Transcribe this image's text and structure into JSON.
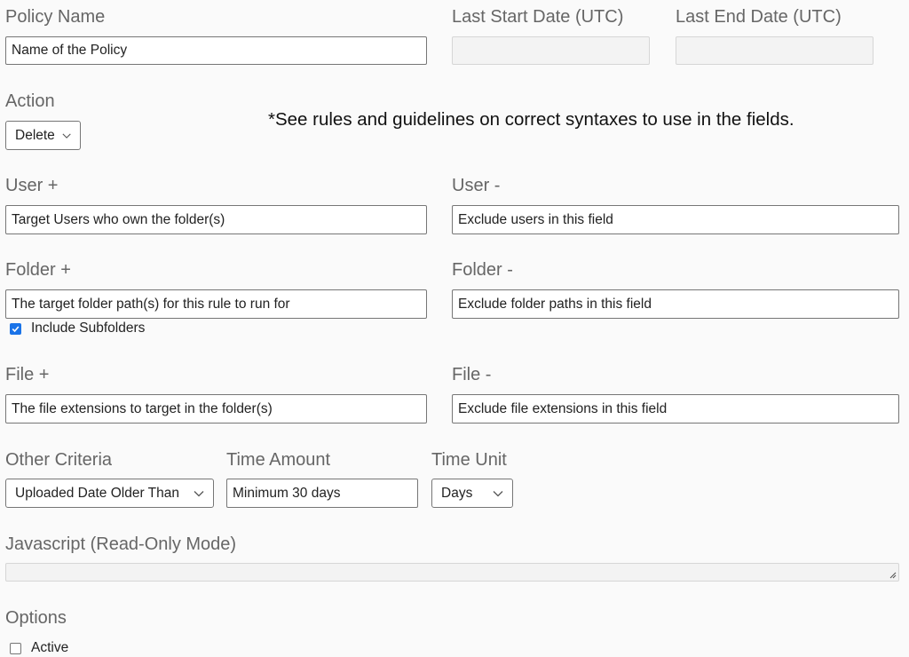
{
  "policy_name": {
    "label": "Policy Name",
    "value": "Name of the Policy"
  },
  "last_start_date": {
    "label": "Last Start Date (UTC)",
    "value": ""
  },
  "last_end_date": {
    "label": "Last End Date (UTC)",
    "value": ""
  },
  "action": {
    "label": "Action",
    "selected": "Delete"
  },
  "syntax_note": "*See rules and guidelines on correct syntaxes to use in the fields.",
  "user_include": {
    "label": "User +",
    "value": "Target Users who own the folder(s)"
  },
  "user_exclude": {
    "label": "User -",
    "value": "Exclude users in this field"
  },
  "folder_include": {
    "label": "Folder +",
    "value": "The target folder path(s) for this rule to run for"
  },
  "folder_exclude": {
    "label": "Folder -",
    "value": "Exclude folder paths in this field"
  },
  "include_subfolders": {
    "label": "Include Subfolders",
    "checked": true
  },
  "file_include": {
    "label": "File +",
    "value": "The file extensions to target in the folder(s)"
  },
  "file_exclude": {
    "label": "File -",
    "value": "Exclude file extensions in this field"
  },
  "other_criteria": {
    "label": "Other Criteria",
    "selected": "Uploaded Date Older Than"
  },
  "time_amount": {
    "label": "Time Amount",
    "value": "Minimum 30 days"
  },
  "time_unit": {
    "label": "Time Unit",
    "selected": "Days"
  },
  "javascript": {
    "label": "Javascript (Read-Only Mode)",
    "value": ""
  },
  "options": {
    "label": "Options",
    "active_label": "Active",
    "active_checked": false
  },
  "colors": {
    "label_gray": "#666666",
    "checkbox_blue": "#1a73e8",
    "disabled_bg": "#f3f3f3",
    "page_bg": "#fafafa"
  }
}
